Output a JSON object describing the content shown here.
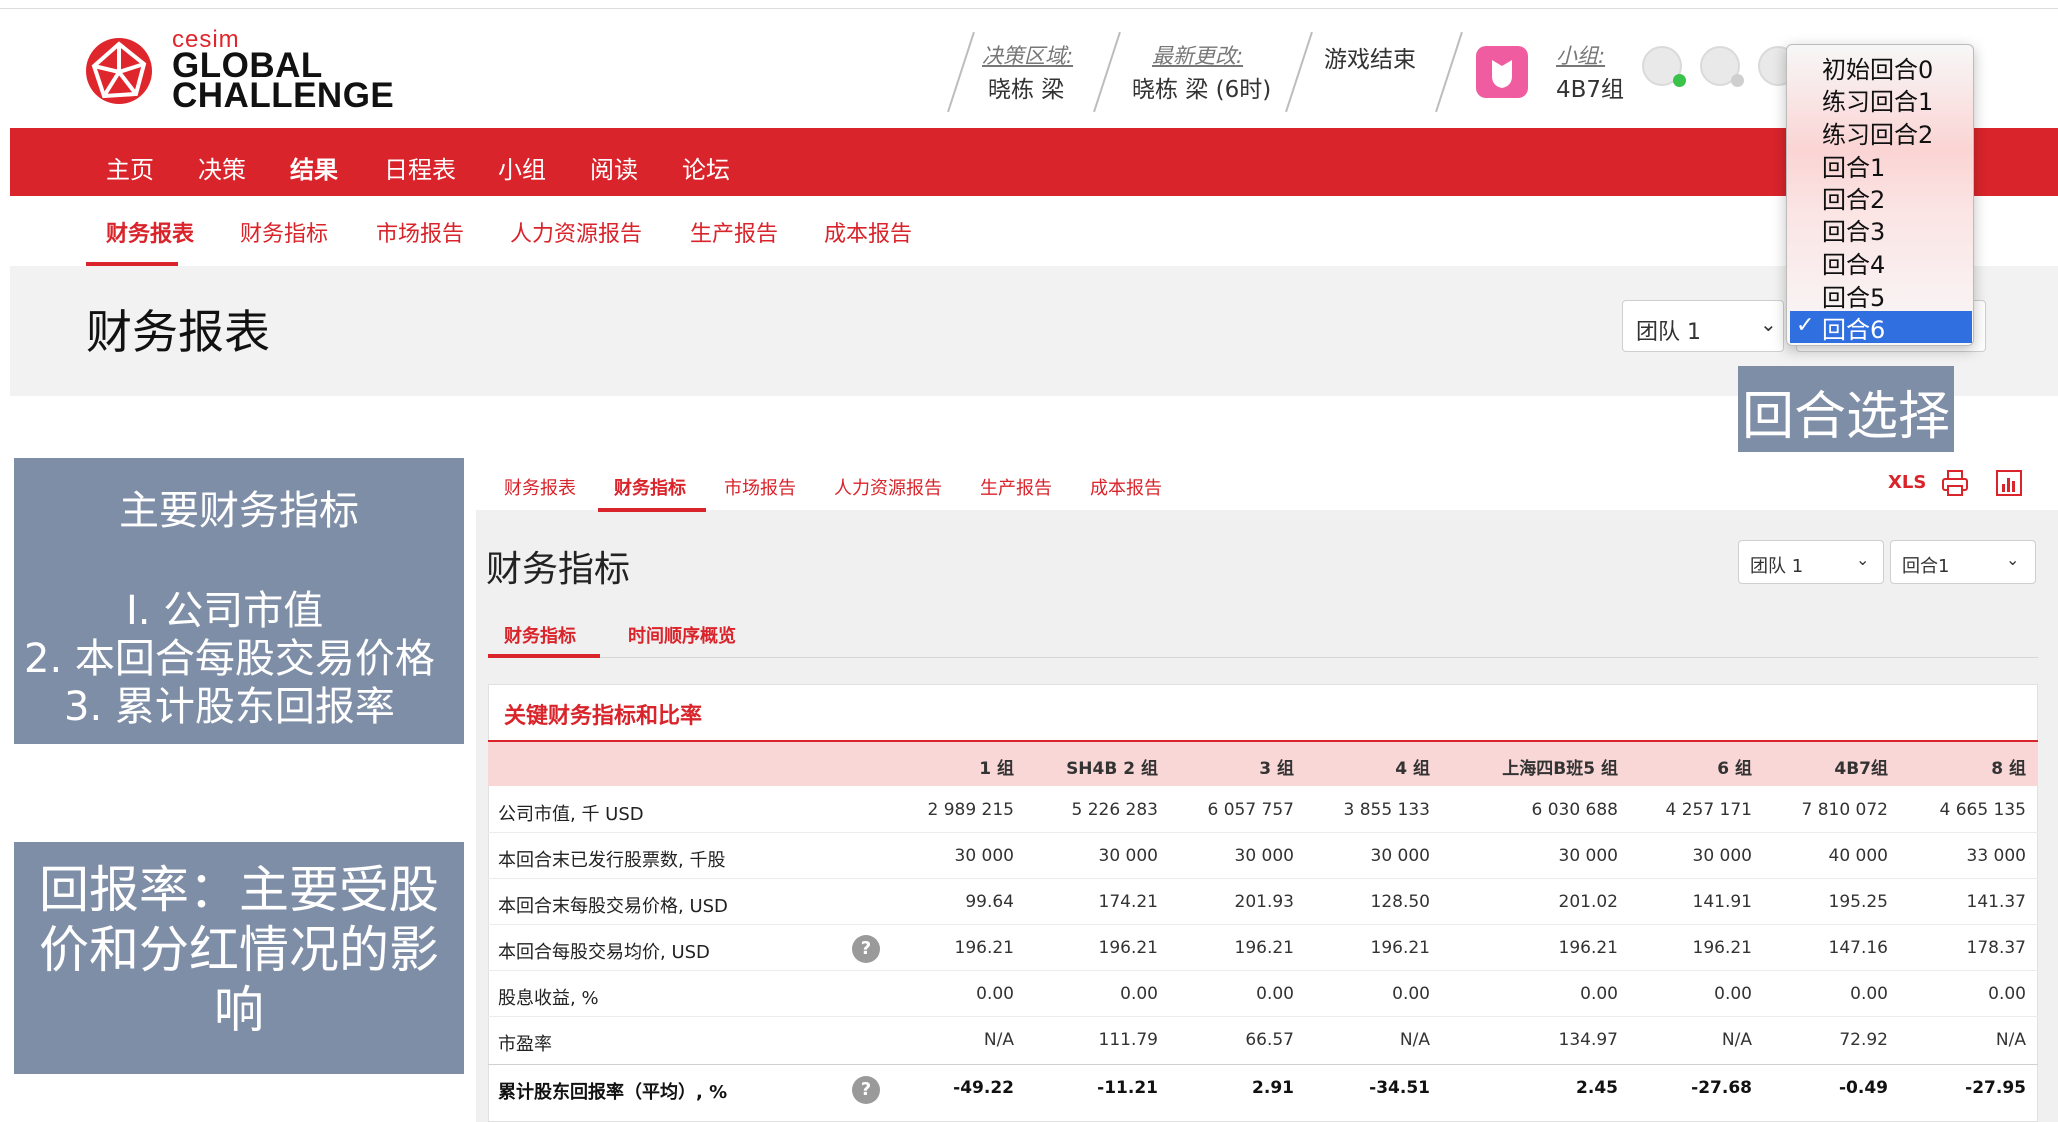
{
  "brand": {
    "small": "cesim",
    "line1": "GLOBAL",
    "line2": "CHALLENGE"
  },
  "header": {
    "decision_area_label": "决策区域:",
    "decision_area_value": "晓栋 梁",
    "last_change_label": "最新更改:",
    "last_change_value": "晓栋 梁 (6时)",
    "game_status": "游戏结束",
    "team_label": "小组:",
    "team_value": "4B7组"
  },
  "nav": {
    "items": [
      "主页",
      "决策",
      "结果",
      "日程表",
      "小组",
      "阅读",
      "论坛"
    ],
    "active": "结果"
  },
  "subnav": {
    "items": [
      "财务报表",
      "财务指标",
      "市场报告",
      "人力资源报告",
      "生产报告",
      "成本报告"
    ],
    "active": "财务报表"
  },
  "page": {
    "title": "财务报表",
    "team_select": "团队 1"
  },
  "round_menu": {
    "items": [
      "初始回合0",
      "练习回合1",
      "练习回合2",
      "回合1",
      "回合2",
      "回合3",
      "回合4",
      "回合5",
      "回合6"
    ],
    "selected": "回合6"
  },
  "notes": {
    "round": "回合选择",
    "main_title": "主要财务指标",
    "main_items": [
      "I.    公司市值",
      "2.    本回合每股交易价格",
      "3.    累计股东回报率"
    ],
    "returns": "回报率：主要受股价和分红情况的影响"
  },
  "report": {
    "tabs": [
      "财务报表",
      "财务指标",
      "市场报告",
      "人力资源报告",
      "生产报告",
      "成本报告"
    ],
    "active_tab": "财务指标",
    "xls": "XLS",
    "title": "财务指标",
    "team_select": "团队 1",
    "round_select": "回合1",
    "subtabs": [
      "财务指标",
      "时间顺序概览"
    ],
    "card_title": "关键财务指标和比率",
    "columns": [
      "1 组",
      "SH4B 2 组",
      "3 组",
      "4 组",
      "上海四B班5 组",
      "6 组",
      "4B7组",
      "8 组"
    ],
    "rows": [
      {
        "label": "公司市值, 千 USD",
        "values": [
          "2 989 215",
          "5 226 283",
          "6 057 757",
          "3 855 133",
          "6 030 688",
          "4 257 171",
          "7 810 072",
          "4 665 135"
        ]
      },
      {
        "label": "本回合末已发行股票数, 千股",
        "values": [
          "30 000",
          "30 000",
          "30 000",
          "30 000",
          "30 000",
          "30 000",
          "40 000",
          "33 000"
        ]
      },
      {
        "label": "本回合末每股交易价格, USD",
        "values": [
          "99.64",
          "174.21",
          "201.93",
          "128.50",
          "201.02",
          "141.91",
          "195.25",
          "141.37"
        ]
      },
      {
        "label": "本回合每股交易均价, USD",
        "values": [
          "196.21",
          "196.21",
          "196.21",
          "196.21",
          "196.21",
          "196.21",
          "147.16",
          "178.37"
        ]
      },
      {
        "label": "股息收益, %",
        "values": [
          "0.00",
          "0.00",
          "0.00",
          "0.00",
          "0.00",
          "0.00",
          "0.00",
          "0.00"
        ]
      },
      {
        "label": "市盈率",
        "values": [
          "N/A",
          "111.79",
          "66.57",
          "N/A",
          "134.97",
          "N/A",
          "72.92",
          "N/A"
        ]
      },
      {
        "label": "累计股东回报率（平均）, %",
        "values": [
          "-49.22",
          "-11.21",
          "2.91",
          "-34.51",
          "2.45",
          "-27.68",
          "-0.49",
          "-27.95"
        ]
      }
    ],
    "help_glyph": "?"
  },
  "colors": {
    "brand_red": "#d9242b",
    "note_bg": "#7f8ea7",
    "menu_selected": "#2f6fe0"
  }
}
